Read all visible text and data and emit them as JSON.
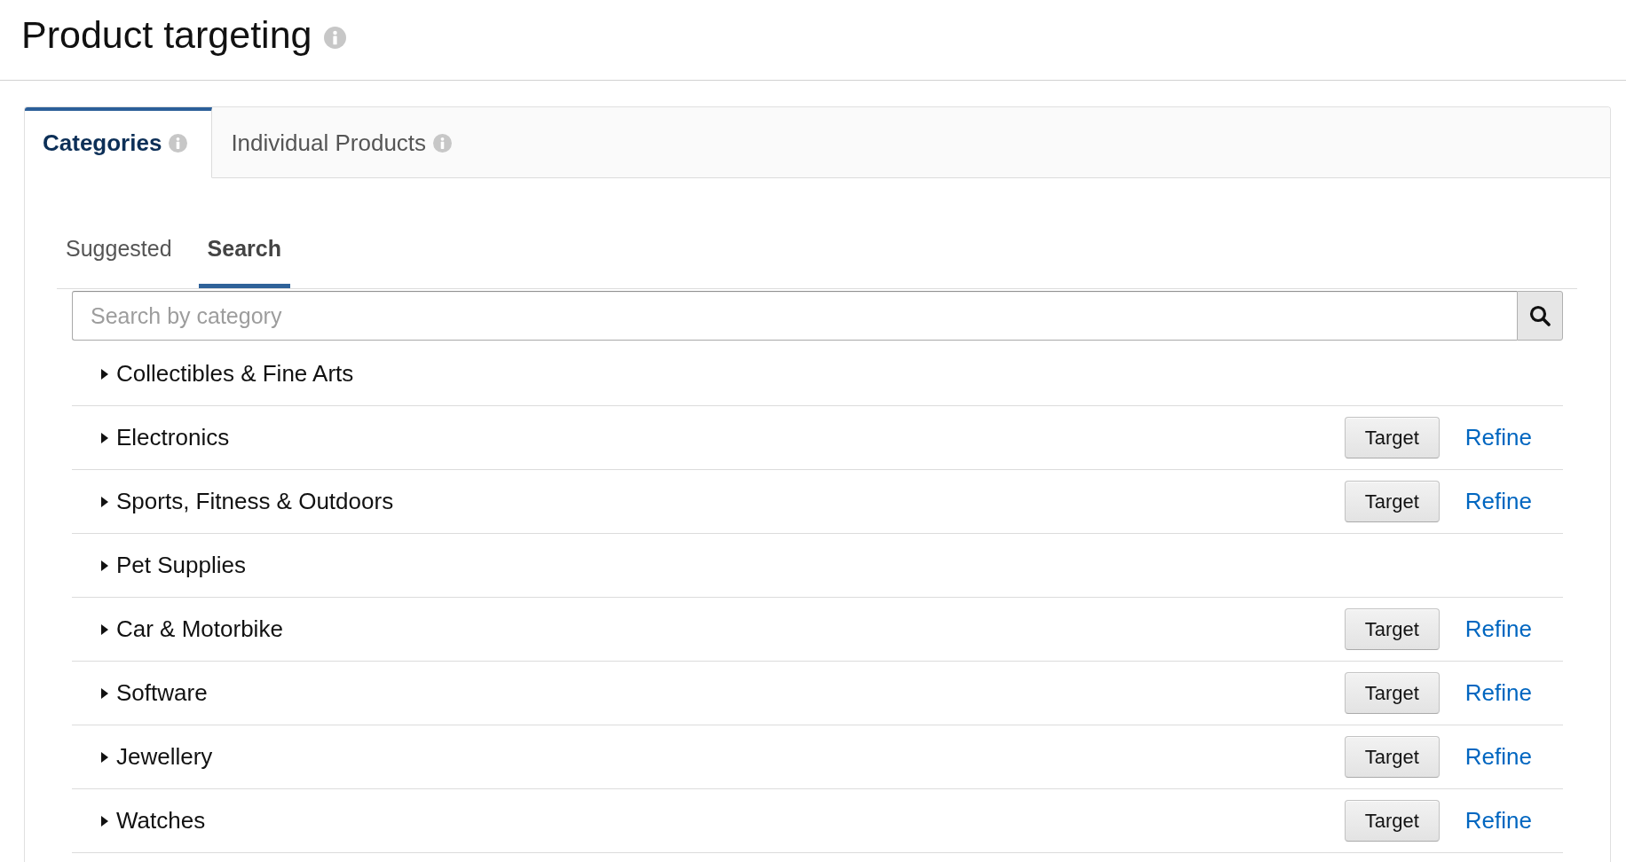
{
  "page": {
    "title": "Product targeting"
  },
  "tabs": [
    {
      "label": "Categories",
      "selected": true
    },
    {
      "label": "Individual Products",
      "selected": false
    }
  ],
  "subtabs": [
    {
      "label": "Suggested",
      "selected": false
    },
    {
      "label": "Search",
      "selected": true
    }
  ],
  "search": {
    "placeholder": "Search by category"
  },
  "categories": [
    {
      "label": "Collectibles & Fine Arts",
      "expanded": false
    },
    {
      "label": "Electronics",
      "expanded": false,
      "target_button": "Target",
      "refine_link": "Refine"
    },
    {
      "label": "Sports, Fitness & Outdoors",
      "expanded": false,
      "target_button": "Target",
      "refine_link": "Refine"
    },
    {
      "label": "Pet Supplies",
      "expanded": false
    },
    {
      "label": "Car & Motorbike",
      "expanded": false,
      "target_button": "Target",
      "refine_link": "Refine"
    },
    {
      "label": "Software",
      "expanded": false,
      "target_button": "Target",
      "refine_link": "Refine"
    },
    {
      "label": "Jewellery",
      "expanded": false,
      "target_button": "Target",
      "refine_link": "Refine"
    },
    {
      "label": "Watches",
      "expanded": false,
      "target_button": "Target",
      "refine_link": "Refine"
    }
  ]
}
